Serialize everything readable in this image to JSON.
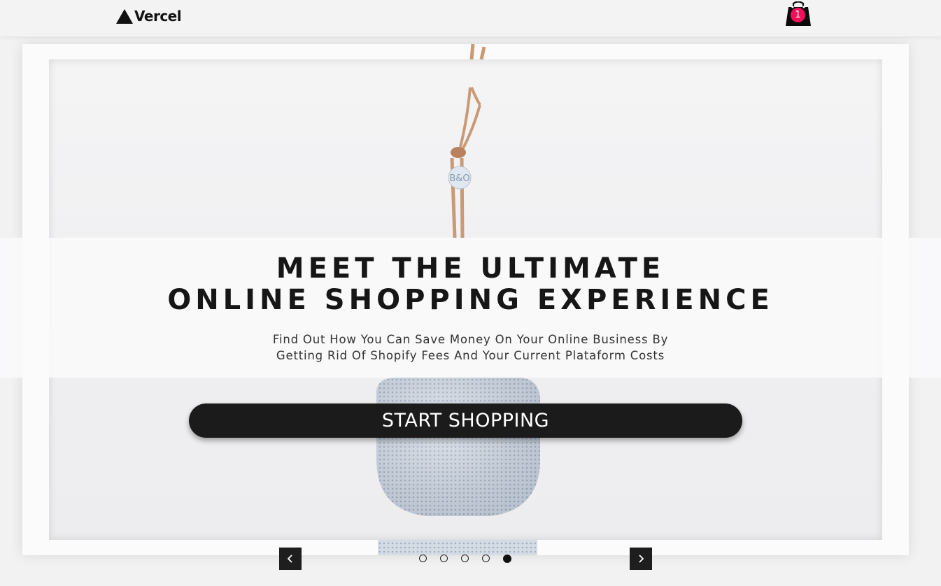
{
  "header": {
    "logo_text": "Vercel",
    "cart_count": "1"
  },
  "hero": {
    "headline_line1": "MEET THE ULTIMATE",
    "headline_line2": "ONLINE SHOPPING EXPERIENCE",
    "subtext_line1": "Find Out How You Can Save Money On Your Online Business By",
    "subtext_line2": "Getting Rid Of Shopify Fees And Your Current Plataform Costs",
    "cta_label": "START SHOPPING",
    "product_tag_text": "B&O"
  },
  "carousel": {
    "prev_icon": "chevron-left-icon",
    "next_icon": "chevron-right-icon",
    "slide_count": 5,
    "active_slide": 5
  },
  "colors": {
    "cart_badge": "#f0105a",
    "cta_background": "#1b1b1b",
    "strap": "#c99a75",
    "speaker": "#c9d2de"
  }
}
